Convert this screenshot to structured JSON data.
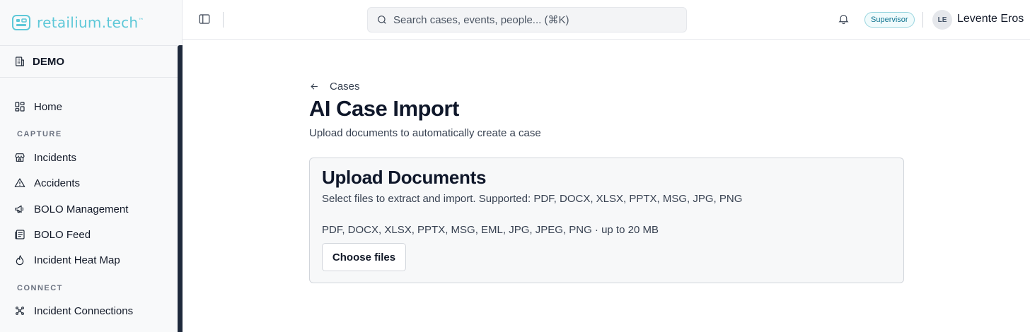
{
  "brand": {
    "name": "retailium.tech",
    "trademark": "™",
    "color": "#5ec8d8"
  },
  "org": {
    "label": "DEMO",
    "icon": "building-icon"
  },
  "sidebar": {
    "home": {
      "label": "Home",
      "icon": "dashboard-grid-icon"
    },
    "sections": [
      {
        "title": "CAPTURE",
        "items": [
          {
            "label": "Incidents",
            "icon": "store-icon"
          },
          {
            "label": "Accidents",
            "icon": "warning-triangle-icon"
          },
          {
            "label": "BOLO Management",
            "icon": "megaphone-icon"
          },
          {
            "label": "BOLO Feed",
            "icon": "newspaper-icon"
          },
          {
            "label": "Incident Heat Map",
            "icon": "flame-icon"
          }
        ]
      },
      {
        "title": "CONNECT",
        "items": [
          {
            "label": "Incident Connections",
            "icon": "network-icon"
          }
        ]
      }
    ]
  },
  "topbar": {
    "search_placeholder": "Search cases, events, people... (⌘K)",
    "role": "Supervisor",
    "user_initials": "LE",
    "user_name": "Levente Eros"
  },
  "main": {
    "back_label": "Cases",
    "title": "AI Case Import",
    "subtitle": "Upload documents to automatically create a case",
    "card": {
      "title": "Upload Documents",
      "description": "Select files to extract and import. Supported: PDF, DOCX, XLSX, PPTX, MSG, JPG, PNG",
      "types_hint": "PDF, DOCX, XLSX, PPTX, MSG, EML, JPG, JPEG, PNG · up to 20 MB",
      "button_label": "Choose files"
    }
  }
}
